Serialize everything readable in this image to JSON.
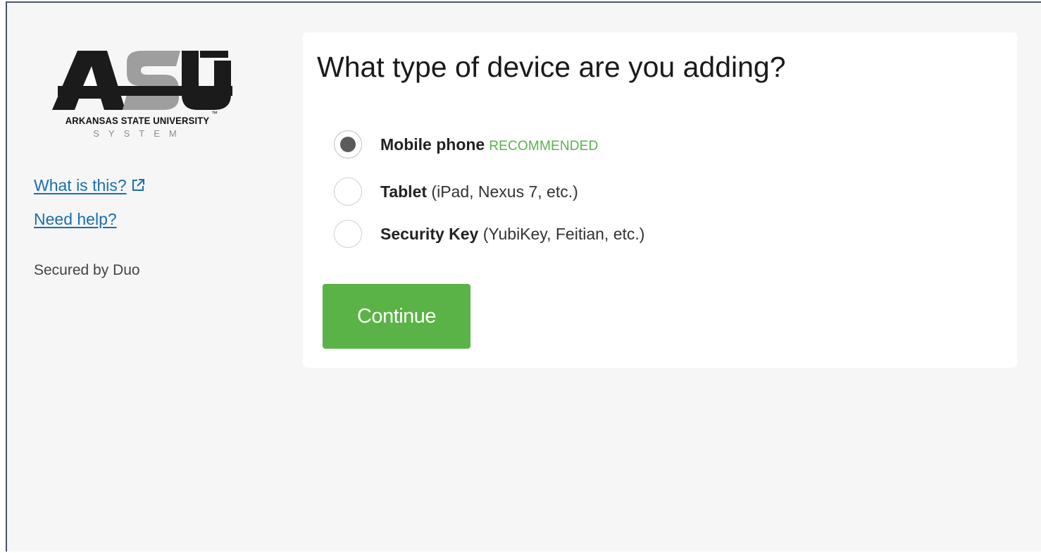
{
  "sidebar": {
    "logo": {
      "letters": "ASU",
      "tm": "™",
      "university": "ARKANSAS STATE UNIVERSITY",
      "system": "SYSTEM"
    },
    "links": {
      "what_is_this": "What is this?",
      "need_help": "Need help?"
    },
    "secured_by": "Secured by Duo"
  },
  "main": {
    "title": "What type of device are you adding?",
    "options": [
      {
        "label": "Mobile phone",
        "detail": "",
        "badge": "RECOMMENDED",
        "selected": true
      },
      {
        "label": "Tablet",
        "detail": " (iPad, Nexus 7, etc.)",
        "badge": "",
        "selected": false
      },
      {
        "label": "Security Key",
        "detail": " (YubiKey, Feitian, etc.)",
        "badge": "",
        "selected": false
      }
    ],
    "continue_label": "Continue"
  },
  "colors": {
    "accent_green": "#5ab346",
    "recommended_green": "#5ab14d",
    "link_blue": "#1a6eb0",
    "page_background": "#f6f6f6"
  },
  "icons": {
    "external_link": "external-link-icon"
  }
}
